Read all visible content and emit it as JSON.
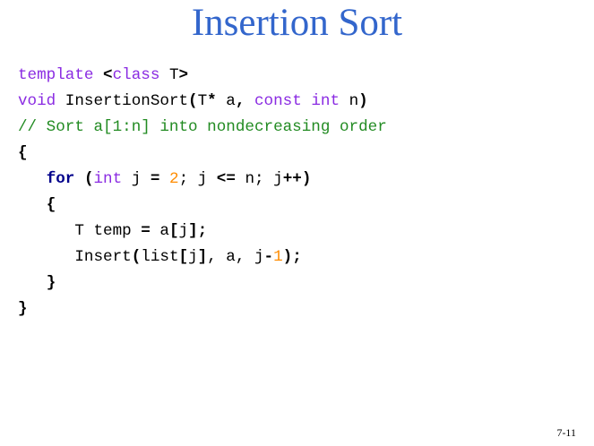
{
  "slide": {
    "title": "Insertion Sort",
    "page_number": "7-11"
  },
  "code": {
    "lines": [
      [
        {
          "text": "template ",
          "style": "kw"
        },
        {
          "text": "<",
          "style": "op"
        },
        {
          "text": "class",
          "style": "kw"
        },
        {
          "text": " T",
          "style": "id"
        },
        {
          "text": ">",
          "style": "op"
        }
      ],
      [
        {
          "text": "void",
          "style": "kw"
        },
        {
          "text": " InsertionSort",
          "style": "id"
        },
        {
          "text": "(",
          "style": "op"
        },
        {
          "text": "T",
          "style": "id"
        },
        {
          "text": "*",
          "style": "op"
        },
        {
          "text": " a",
          "style": "id"
        },
        {
          "text": ",",
          "style": "op"
        },
        {
          "text": " ",
          "style": "id"
        },
        {
          "text": "const",
          "style": "kw"
        },
        {
          "text": " ",
          "style": "id"
        },
        {
          "text": "int",
          "style": "kw"
        },
        {
          "text": " n",
          "style": "id"
        },
        {
          "text": ")",
          "style": "op"
        }
      ],
      [
        {
          "text": "// Sort a[1:n] into nondecreasing order",
          "style": "cmt"
        }
      ],
      [
        {
          "text": "{",
          "style": "op"
        }
      ],
      [
        {
          "text": "   ",
          "style": "id"
        },
        {
          "text": "for",
          "style": "kwb"
        },
        {
          "text": " ",
          "style": "id"
        },
        {
          "text": "(",
          "style": "op"
        },
        {
          "text": "int",
          "style": "kw"
        },
        {
          "text": " j ",
          "style": "id"
        },
        {
          "text": "=",
          "style": "op"
        },
        {
          "text": " ",
          "style": "id"
        },
        {
          "text": "2",
          "style": "num"
        },
        {
          "text": "; j ",
          "style": "id"
        },
        {
          "text": "<=",
          "style": "op"
        },
        {
          "text": " n; j",
          "style": "id"
        },
        {
          "text": "++)",
          "style": "op"
        }
      ],
      [
        {
          "text": "   ",
          "style": "id"
        },
        {
          "text": "{",
          "style": "op"
        }
      ],
      [
        {
          "text": "      T temp ",
          "style": "id"
        },
        {
          "text": "=",
          "style": "op"
        },
        {
          "text": " a",
          "style": "id"
        },
        {
          "text": "[",
          "style": "op"
        },
        {
          "text": "j",
          "style": "id"
        },
        {
          "text": "];",
          "style": "op"
        }
      ],
      [
        {
          "text": "      Insert",
          "style": "id"
        },
        {
          "text": "(",
          "style": "op"
        },
        {
          "text": "list",
          "style": "id"
        },
        {
          "text": "[",
          "style": "op"
        },
        {
          "text": "j",
          "style": "id"
        },
        {
          "text": "]",
          "style": "op"
        },
        {
          "text": ", a, j",
          "style": "id"
        },
        {
          "text": "-",
          "style": "op"
        },
        {
          "text": "1",
          "style": "num"
        },
        {
          "text": ");",
          "style": "op"
        }
      ],
      [
        {
          "text": "   ",
          "style": "id"
        },
        {
          "text": "}",
          "style": "op"
        }
      ],
      [
        {
          "text": "}",
          "style": "op"
        }
      ]
    ]
  }
}
